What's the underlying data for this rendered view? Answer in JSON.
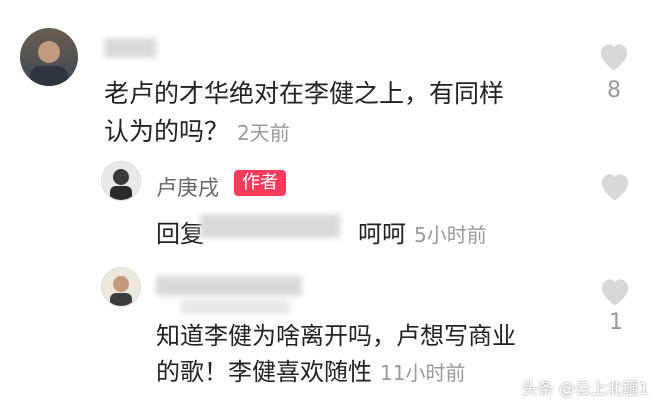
{
  "comments": [
    {
      "text_line1": "老卢的才华绝对在李健之上，有同样",
      "text_line2": "认为的吗？",
      "time": "2天前",
      "likes": "8"
    },
    {
      "author": "卢庚戌",
      "badge": "作者",
      "reply_prefix": "回复",
      "text": "呵呵",
      "time": "5小时前"
    },
    {
      "text_line1": "知道李健为啥离开吗，卢想写商业",
      "text_line2": "的歌！李健喜欢随性",
      "time": "11小时前",
      "likes": "1"
    }
  ],
  "watermark": "头条 @云上北疆1",
  "colors": {
    "badge": "#ff3b5c",
    "meta": "#9a9a9a",
    "heart": "#d8d8d8"
  }
}
